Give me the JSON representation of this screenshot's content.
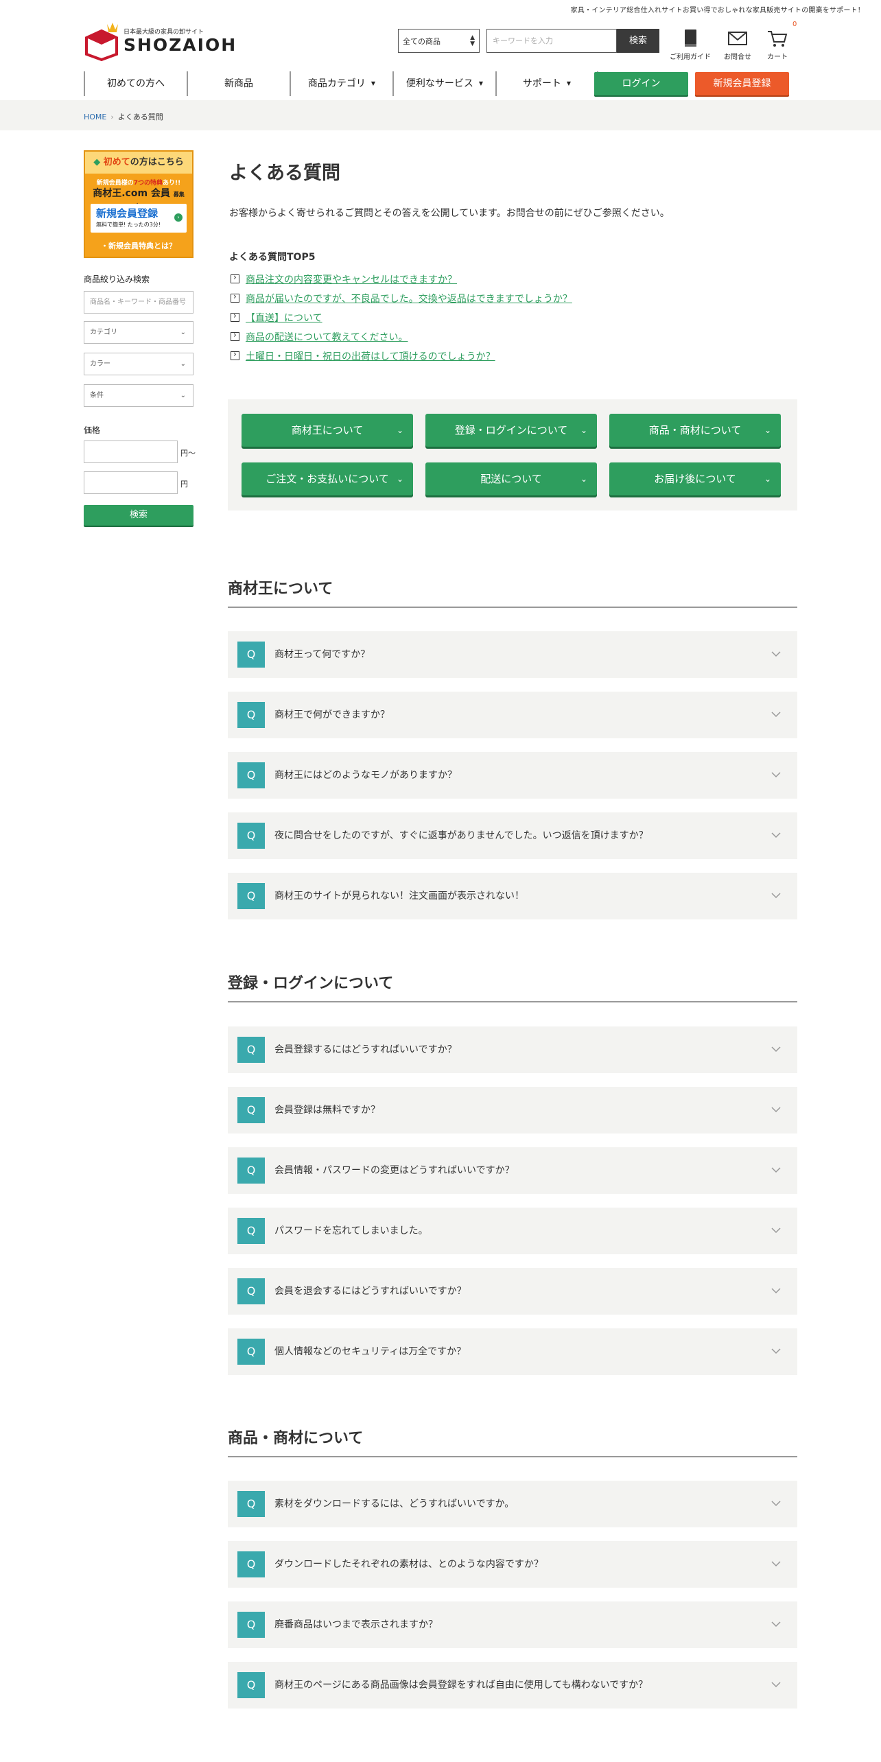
{
  "header": {
    "tagline": "家具・インテリア総合仕入れサイトお買い得でおしゃれな家具販売サイトの開業をサポート！",
    "logo_tag": "日本最大級の家具の卸サイト",
    "logo_name": "SHOZAIOH",
    "search_select": "全ての商品",
    "search_placeholder": "キーワードを入力",
    "search_button": "検索",
    "guide_label": "ご利用ガイド",
    "contact_label": "お問合せ",
    "cart_label": "カート",
    "cart_count": "0"
  },
  "nav": {
    "items": [
      "初めての方へ",
      "新商品",
      "商品カテゴリ",
      "便利なサービス",
      "サポート"
    ],
    "login": "ログイン",
    "signup": "新規会員登録"
  },
  "breadcrumb": {
    "home": "HOME",
    "current": "よくある質問"
  },
  "sidebar": {
    "banner": {
      "head_accent": "初めて",
      "head_rest": "の方はこちら",
      "line1_a": "新規会員様の",
      "line1_b": "7つの特典",
      "line1_c": "あり!!",
      "line2": "商材王.com 会員",
      "line2_small": "募集中!",
      "signup": "新規会員登録",
      "signup_sub": "無料で簡単! たったの3分!",
      "footer": "・新規会員特典とは？"
    },
    "filter_title": "商品絞り込み検索",
    "keyword_placeholder": "商品名・キーワード・商品番号",
    "category": "カテゴリ",
    "color": "カラー",
    "condition": "条件",
    "price_title": "価格",
    "price_from_unit": "円〜",
    "price_to_unit": "円",
    "search_button": "検索"
  },
  "main": {
    "title": "よくある質問",
    "intro": "お客様からよく寄せられるご質問とその答えを公開しています。お問合せの前にぜひご参照ください。",
    "top5_title": "よくある質問TOP5",
    "top5": [
      "商品注文の内容変更やキャンセルはできますか？",
      "商品が届いたのですが、不良品でした。交換や返品はできますでしょうか？",
      "【直送】について",
      "商品の配送について教えてください。",
      "土曜日・日曜日・祝日の出荷はして頂けるのでしょうか？"
    ],
    "categories": [
      "商材王について",
      "登録・ログインについて",
      "商品・商材について",
      "ご注文・お支払いについて",
      "配送について",
      "お届け後について"
    ],
    "q_mark": "Q",
    "sections": [
      {
        "title": "商材王について",
        "questions": [
          "商材王って何ですか？",
          "商材王で何ができますか？",
          "商材王にはどのようなモノがありますか？",
          "夜に問合せをしたのですが、すぐに返事がありませんでした。いつ返信を頂けますか？",
          "商材王のサイトが見られない！注文画面が表示されない！"
        ]
      },
      {
        "title": "登録・ログインについて",
        "questions": [
          "会員登録するにはどうすればいいですか？",
          "会員登録は無料ですか？",
          "会員情報・パスワードの変更はどうすればいいですか？",
          "パスワードを忘れてしまいました。",
          "会員を退会するにはどうすればいいですか？",
          "個人情報などのセキュリティは万全ですか？"
        ]
      },
      {
        "title": "商品・商材について",
        "questions": [
          "素材をダウンロードするには、どうすればいいですか。",
          "ダウンロードしたそれぞれの素材は、とのような内容ですか？",
          "廃番商品はいつまで表示されますか？",
          "商材王のページにある商品画像は会員登録をすれば自由に使用しても構わないですか？"
        ]
      }
    ]
  },
  "colors": {
    "green": "#2e9e5e",
    "orange": "#ec5a2a",
    "teal": "#3aa9ad",
    "panel": "#f3f3f1",
    "link": "#2f6fb0"
  }
}
